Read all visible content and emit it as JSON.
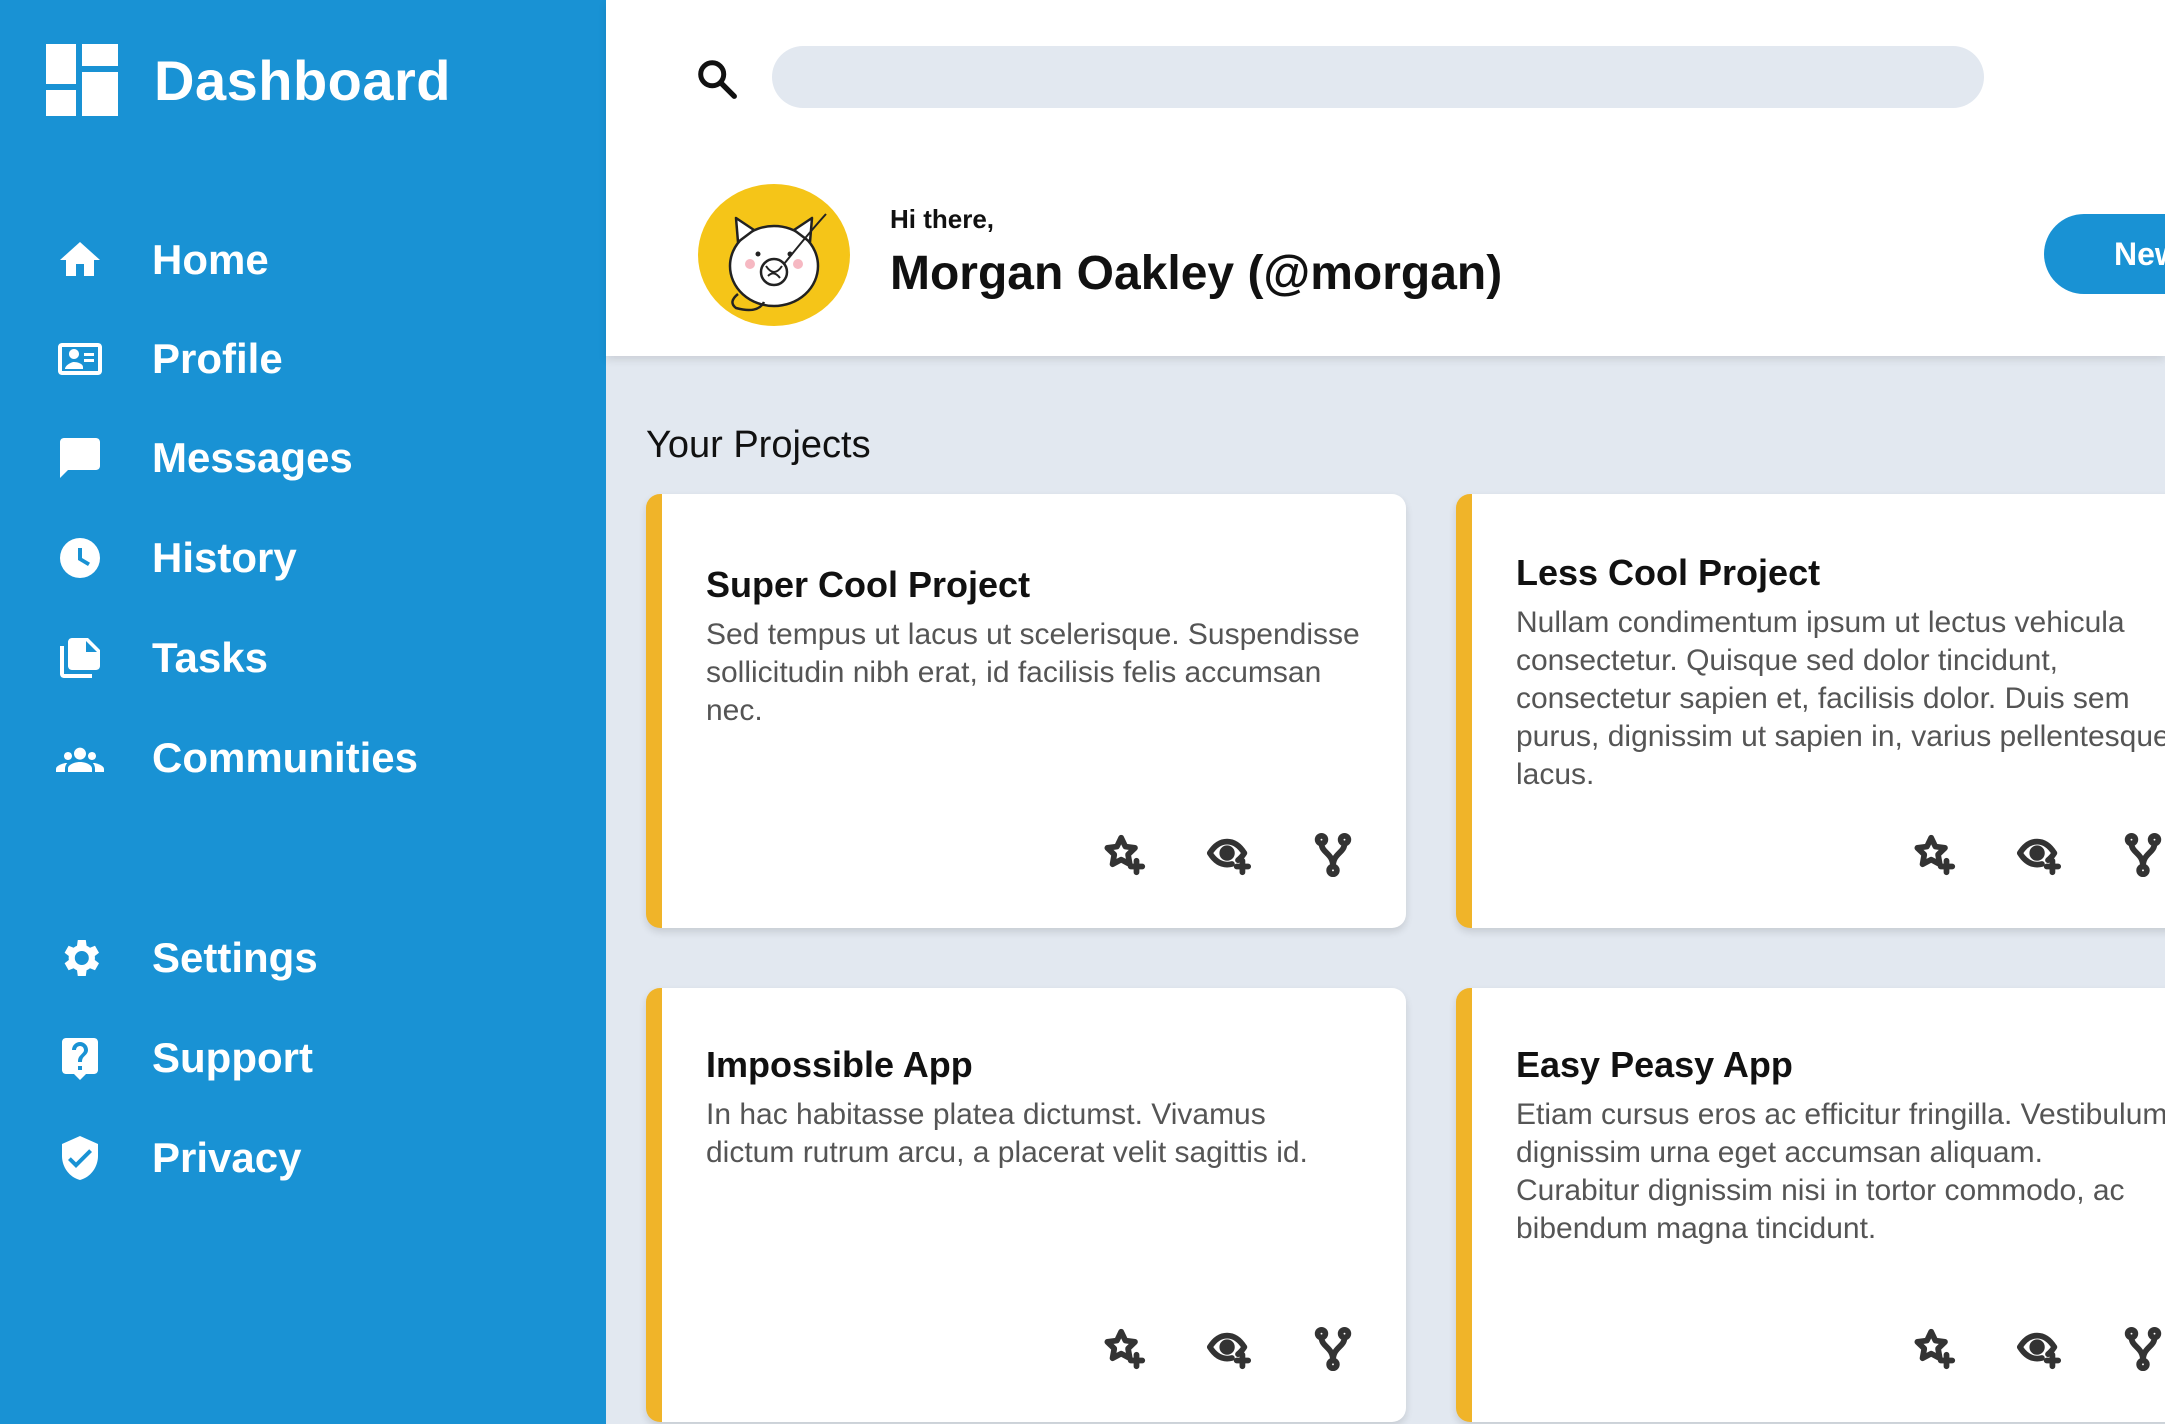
{
  "sidebar": {
    "brand_title": "Dashboard",
    "primary_nav": [
      {
        "label": "Home",
        "icon": "home-icon"
      },
      {
        "label": "Profile",
        "icon": "profile-card-icon"
      },
      {
        "label": "Messages",
        "icon": "message-icon"
      },
      {
        "label": "History",
        "icon": "clock-icon"
      },
      {
        "label": "Tasks",
        "icon": "documents-icon"
      },
      {
        "label": "Communities",
        "icon": "people-icon"
      }
    ],
    "secondary_nav": [
      {
        "label": "Settings",
        "icon": "gear-icon"
      },
      {
        "label": "Support",
        "icon": "help-icon"
      },
      {
        "label": "Privacy",
        "icon": "shield-check-icon"
      }
    ]
  },
  "header": {
    "search": {
      "placeholder": "",
      "value": ""
    },
    "greeting": "Hi there,",
    "user_name": "Morgan Oakley (@morgan)",
    "new_button_label": "New"
  },
  "main": {
    "section_title": "Your Projects",
    "projects": [
      {
        "title": "Super Cool Project",
        "description": "Sed tempus ut lacus ut scelerisque. Suspendisse sollicitudin nibh erat, id facilisis felis accumsan nec."
      },
      {
        "title": "Less Cool Project",
        "description": "Nullam condimentum ipsum ut lectus vehicula consectetur. Quisque sed dolor tincidunt, consectetur sapien et, facilisis dolor. Duis sem purus, dignissim ut sapien in, varius pellentesque lacus."
      },
      {
        "title": "Impossible App",
        "description": "In hac habitasse platea dictumst. Vivamus dictum rutrum arcu, a placerat velit sagittis id."
      },
      {
        "title": "Easy Peasy App",
        "description": "Etiam cursus eros ac efficitur fringilla. Vestibulum dignissim urna eget accumsan aliquam. Curabitur dignissim nisi in tortor commodo, ac bibendum magna tincidunt."
      }
    ],
    "card_actions": [
      "star-add-icon",
      "watch-add-icon",
      "fork-icon"
    ]
  },
  "colors": {
    "sidebar": "#1992d4",
    "accent": "#f0b429",
    "background": "#e2e8f0",
    "avatar_bg": "#f5c518"
  }
}
